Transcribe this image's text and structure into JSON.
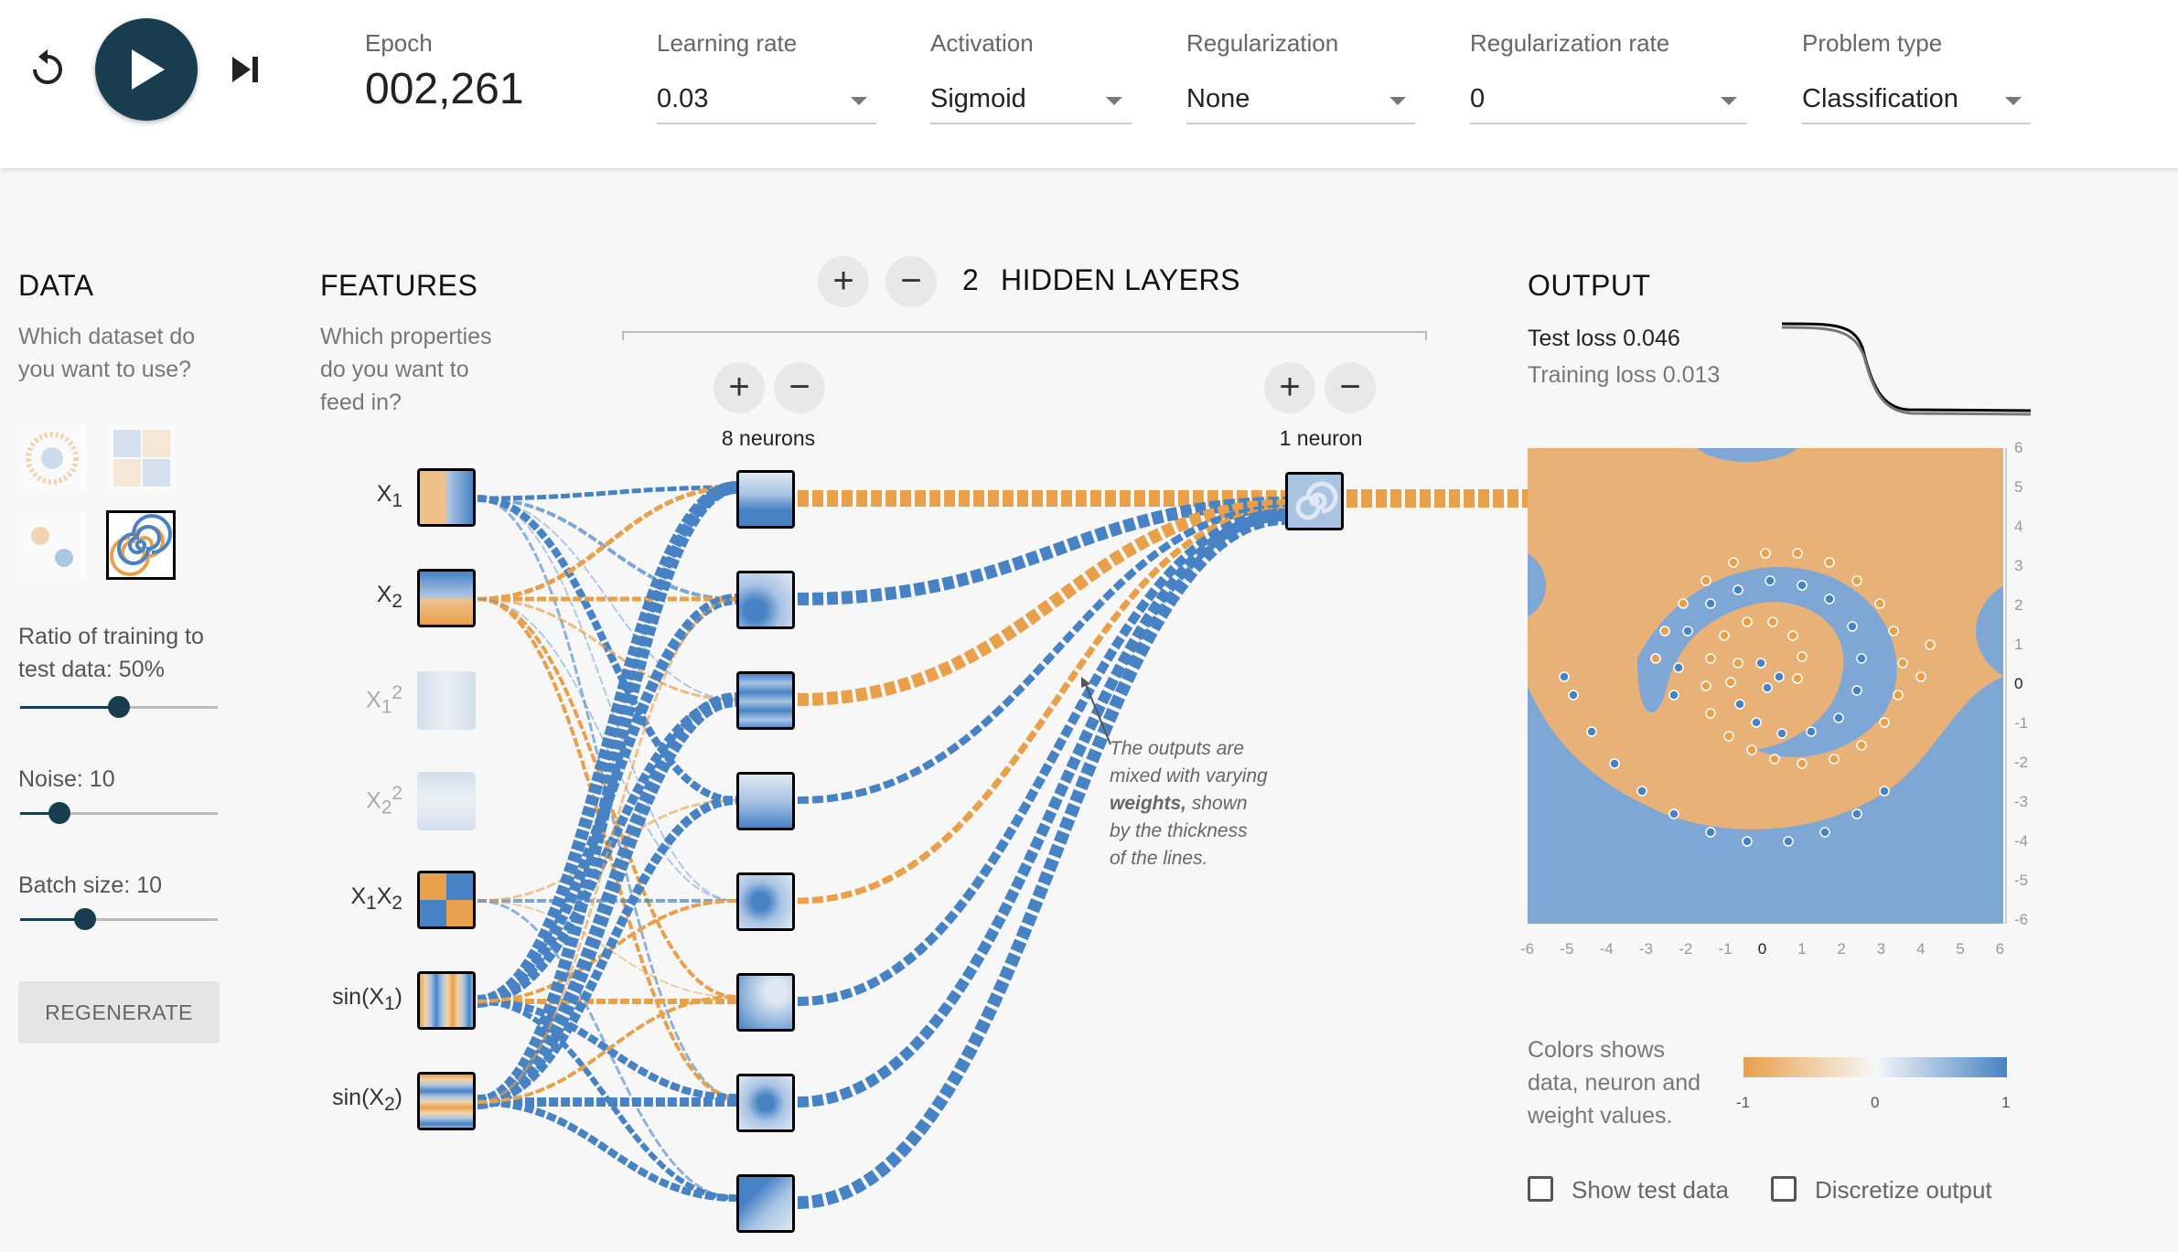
{
  "controls": {
    "epoch_label": "Epoch",
    "epoch_value": "002,261",
    "learning_rate": {
      "label": "Learning rate",
      "value": "0.03"
    },
    "activation": {
      "label": "Activation",
      "value": "Sigmoid"
    },
    "regularization": {
      "label": "Regularization",
      "value": "None"
    },
    "regularization_rate": {
      "label": "Regularization rate",
      "value": "0"
    },
    "problem_type": {
      "label": "Problem type",
      "value": "Classification"
    }
  },
  "data_panel": {
    "title": "DATA",
    "question": [
      "Which dataset do",
      "you want to use?"
    ],
    "ratio_label": [
      "Ratio of training to",
      "test data:  50%"
    ],
    "ratio": 0.5,
    "noise_label": "Noise:  10",
    "noise": 0.2,
    "batch_label": "Batch size:  10",
    "batch": 0.33,
    "regenerate_label": "REGENERATE",
    "selected_dataset": "spiral"
  },
  "features_panel": {
    "title": "FEATURES",
    "question": [
      "Which properties",
      "do you want to",
      "feed in?"
    ]
  },
  "network": {
    "layer_count": "2",
    "layers_label": "HIDDEN LAYERS",
    "layer1_neurons": "8 neurons",
    "layer2_neurons": "1 neuron",
    "annotation_lines": [
      "The outputs are",
      "mixed with varying",
      "shown",
      "by the thickness",
      "of the lines."
    ],
    "annotation_bold": "weights,"
  },
  "output": {
    "title": "OUTPUT",
    "test_loss": "Test loss 0.046",
    "training_loss": "Training loss 0.013",
    "y_ticks": [
      "6",
      "5",
      "4",
      "3",
      "2",
      "1",
      "0",
      "-1",
      "-2",
      "-3",
      "-4",
      "-5",
      "-6"
    ],
    "x_ticks": [
      "-6",
      "-5",
      "-4",
      "-3",
      "-2",
      "-1",
      "0",
      "1",
      "2",
      "3",
      "4",
      "5",
      "6"
    ],
    "legend_text": [
      "Colors shows",
      "data, neuron and",
      "weight values."
    ],
    "legend_ticks": [
      "-1",
      "0",
      "1"
    ],
    "show_test_data": "Show test data",
    "discretize_output": "Discretize output"
  },
  "colors": {
    "orange": "#e8a04b",
    "blue": "#4782c5",
    "dark": "#183d4e"
  }
}
